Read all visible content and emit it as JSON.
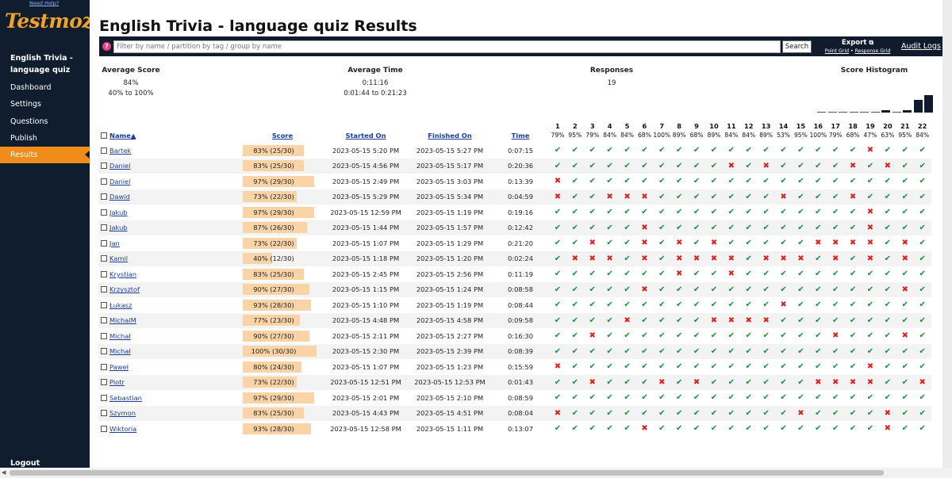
{
  "sidebar": {
    "need_help": "Need Help?",
    "logo": "Testmoz",
    "quiz_name": "English Trivia - language quiz",
    "items": [
      {
        "label": "Dashboard"
      },
      {
        "label": "Settings"
      },
      {
        "label": "Questions"
      },
      {
        "label": "Publish"
      },
      {
        "label": "Results",
        "active": true
      }
    ],
    "logout": "Logout"
  },
  "page_title": "English Trivia - language quiz Results",
  "filter": {
    "placeholder": "Filter by name / partition by tag / group by name",
    "help": "?",
    "search_label": "Search"
  },
  "export": {
    "label": "Export",
    "point_grid": "Point Grid",
    "separator": " • ",
    "response_grid": "Response Grid"
  },
  "audit_logs": "Audit Logs",
  "stats": {
    "average_score": {
      "title": "Average Score",
      "value": "84%",
      "range": "40% to 100%"
    },
    "average_time": {
      "title": "Average Time",
      "value": "0:11:16",
      "range": "0:01:44 to 0:21:23"
    },
    "responses": {
      "title": "Responses",
      "value": "19"
    },
    "histogram": {
      "title": "Score Histogram",
      "counts": [
        0,
        0,
        0,
        0,
        0,
        0,
        1,
        0,
        1,
        5,
        7
      ]
    }
  },
  "columns": {
    "name": "Name▲",
    "score": "Score",
    "started": "Started On",
    "finished": "Finished On",
    "time": "Time"
  },
  "questions": [
    {
      "num": "1",
      "pct": "79%"
    },
    {
      "num": "2",
      "pct": "95%"
    },
    {
      "num": "3",
      "pct": "79%"
    },
    {
      "num": "4",
      "pct": "84%"
    },
    {
      "num": "5",
      "pct": "84%"
    },
    {
      "num": "6",
      "pct": "68%"
    },
    {
      "num": "7",
      "pct": "100%"
    },
    {
      "num": "8",
      "pct": "89%"
    },
    {
      "num": "9",
      "pct": "68%"
    },
    {
      "num": "10",
      "pct": "89%"
    },
    {
      "num": "11",
      "pct": "84%"
    },
    {
      "num": "12",
      "pct": "84%"
    },
    {
      "num": "13",
      "pct": "89%"
    },
    {
      "num": "14",
      "pct": "53%"
    },
    {
      "num": "15",
      "pct": "95%"
    },
    {
      "num": "16",
      "pct": "100%"
    },
    {
      "num": "17",
      "pct": "79%"
    },
    {
      "num": "18",
      "pct": "68%"
    },
    {
      "num": "19",
      "pct": "47%"
    },
    {
      "num": "20",
      "pct": "63%"
    },
    {
      "num": "21",
      "pct": "95%"
    },
    {
      "num": "22",
      "pct": "84%"
    }
  ],
  "rows": [
    {
      "name": "Bartek",
      "score": "83% (25/30)",
      "score_pct": 83,
      "started": "2023-05-15 5:20 PM",
      "finished": "2023-05-15 5:27 PM",
      "time": "0:07:15",
      "marks": "1111111111111111110111"
    },
    {
      "name": "Daniel",
      "score": "83% (25/30)",
      "score_pct": 83,
      "started": "2023-05-15 4:56 PM",
      "finished": "2023-05-15 5:17 PM",
      "time": "0:20:36",
      "marks": "1111111111010111101011"
    },
    {
      "name": "Daniel",
      "score": "97% (29/30)",
      "score_pct": 97,
      "started": "2023-05-15 2:49 PM",
      "finished": "2023-05-15 3:03 PM",
      "time": "0:13:39",
      "marks": "0111111111111111111111"
    },
    {
      "name": "Dawid",
      "score": "73% (22/30)",
      "score_pct": 73,
      "started": "2023-05-15 5:29 PM",
      "finished": "2023-05-15 5:34 PM",
      "time": "0:04:59",
      "marks": "0110001111111011101111"
    },
    {
      "name": "Jakub",
      "score": "97% (29/30)",
      "score_pct": 97,
      "started": "2023-05-15 12:59 PM",
      "finished": "2023-05-15 1:19 PM",
      "time": "0:19:16",
      "marks": "1111111111111111110111"
    },
    {
      "name": "Jakub",
      "score": "87% (26/30)",
      "score_pct": 87,
      "started": "2023-05-15 1:44 PM",
      "finished": "2023-05-15 1:57 PM",
      "time": "0:12:42",
      "marks": "1111101111111111110111"
    },
    {
      "name": "Jan",
      "score": "73% (22/30)",
      "score_pct": 73,
      "started": "2023-05-15 1:07 PM",
      "finished": "2023-05-15 1:29 PM",
      "time": "0:21:20",
      "marks": "1101101010111110000101"
    },
    {
      "name": "Kamil",
      "score": "40% (12/30)",
      "score_pct": 40,
      "started": "2023-05-15 1:18 PM",
      "finished": "2023-05-15 1:20 PM",
      "time": "0:02:24",
      "marks": "1000101000010001010101"
    },
    {
      "name": "Krystian",
      "score": "83% (25/30)",
      "score_pct": 83,
      "started": "2023-05-15 2:45 PM",
      "finished": "2023-05-15 2:56 PM",
      "time": "0:11:19",
      "marks": "1111111011011111111111"
    },
    {
      "name": "Krzysztof",
      "score": "90% (27/30)",
      "score_pct": 90,
      "started": "2023-05-15 1:15 PM",
      "finished": "2023-05-15 1:24 PM",
      "time": "0:08:58",
      "marks": "1111101111111111111101"
    },
    {
      "name": "Łukasz",
      "score": "93% (28/30)",
      "score_pct": 93,
      "started": "2023-05-15 1:10 PM",
      "finished": "2023-05-15 1:19 PM",
      "time": "0:08:44",
      "marks": "1111111111111011111111"
    },
    {
      "name": "MichalM",
      "score": "77% (23/30)",
      "score_pct": 77,
      "started": "2023-05-15 4:48 PM",
      "finished": "2023-05-15 4:58 PM",
      "time": "0:09:58",
      "marks": "1111011110000111111111"
    },
    {
      "name": "Michał",
      "score": "90% (27/30)",
      "score_pct": 90,
      "started": "2023-05-15 2:11 PM",
      "finished": "2023-05-15 2:27 PM",
      "time": "0:16:30",
      "marks": "1101111111111111011101"
    },
    {
      "name": "Michał",
      "score": "100% (30/30)",
      "score_pct": 100,
      "started": "2023-05-15 2:30 PM",
      "finished": "2023-05-15 2:39 PM",
      "time": "0:08:39",
      "marks": "1111111111111111111111"
    },
    {
      "name": "Paweł",
      "score": "80% (24/30)",
      "score_pct": 80,
      "started": "2023-05-15 1:07 PM",
      "finished": "2023-05-15 1:23 PM",
      "time": "0:15:59",
      "marks": "0111111111111111110111"
    },
    {
      "name": "Piotr",
      "score": "73% (22/30)",
      "score_pct": 73,
      "started": "2023-05-15 12:51 PM",
      "finished": "2023-05-15 12:53 PM",
      "time": "0:01:43",
      "marks": "1101110101111110000110"
    },
    {
      "name": "Sebastian",
      "score": "97% (29/30)",
      "score_pct": 97,
      "started": "2023-05-15 2:01 PM",
      "finished": "2023-05-15 2:10 PM",
      "time": "0:08:59",
      "marks": "1111111111111111111111"
    },
    {
      "name": "Szymon",
      "score": "83% (25/30)",
      "score_pct": 83,
      "started": "2023-05-15 4:43 PM",
      "finished": "2023-05-15 4:51 PM",
      "time": "0:08:04",
      "marks": "0111111111111101111011"
    },
    {
      "name": "Wiktoria",
      "score": "93% (28/30)",
      "score_pct": 93,
      "started": "2023-05-15 12:58 PM",
      "finished": "2023-05-15 1:11 PM",
      "time": "0:13:07",
      "marks": "1111101111111111111011"
    }
  ],
  "icons": {
    "check": "check-icon",
    "cross": "cross-icon",
    "copy": "copy-icon"
  },
  "colors": {
    "sidebar": "#0f1d2e",
    "accent": "#f08c1a",
    "logo": "#f0a22b",
    "correct": "#1f8f3a",
    "incorrect": "#d62424",
    "score_bar": "#fad3a7"
  }
}
